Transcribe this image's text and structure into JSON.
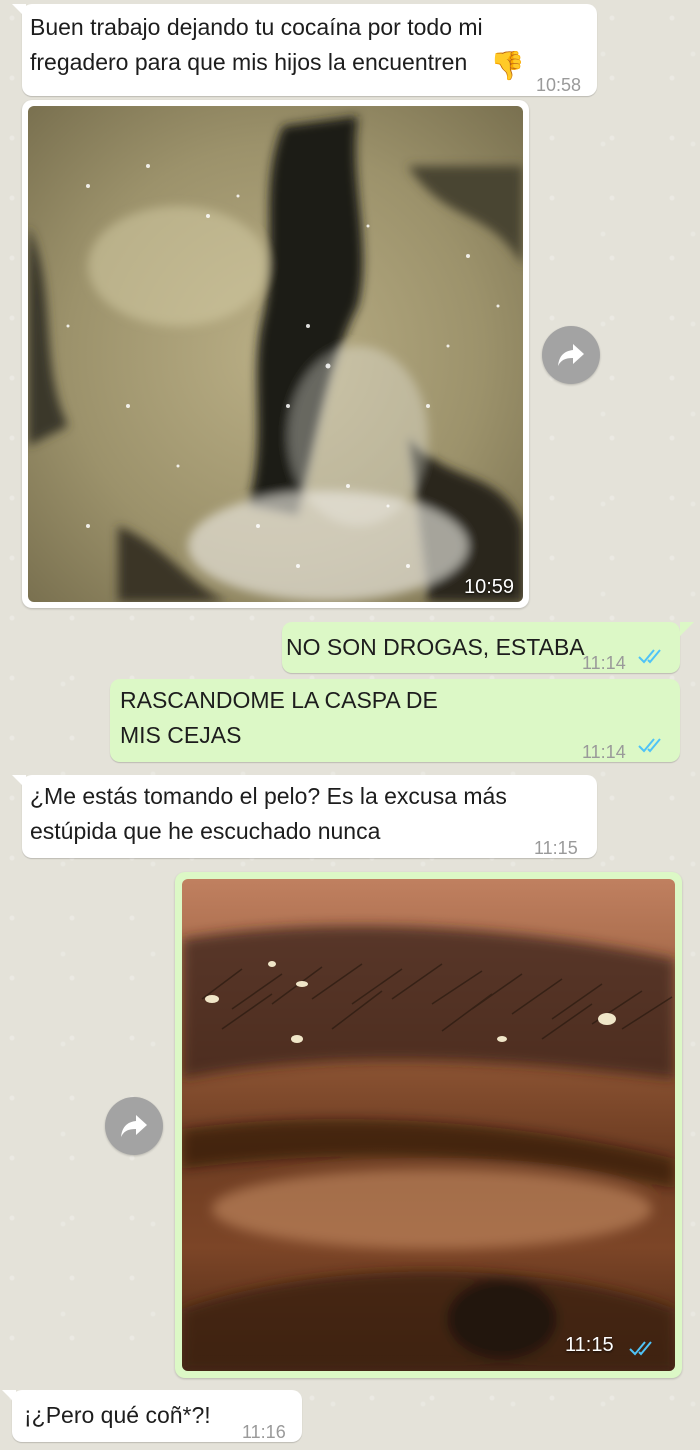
{
  "messages": [
    {
      "text": "Buen trabajo dejando tu cocaína por todo mi fregadero para que mis hijos la encuentren",
      "time": "10:58"
    },
    {
      "image": "marble-countertop-photo",
      "time": "10:59"
    },
    {
      "text": "NO SON DROGAS, ESTABA",
      "time": "11:14"
    },
    {
      "text": "RASCANDOME LA CASPA DE\nMIS CEJAS",
      "time": "11:14"
    },
    {
      "text": "¿Me estás tomando el pelo? Es la excusa más estúpida que he escuchado nunca",
      "time": "11:15"
    },
    {
      "image": "eyebrow-closeup-photo",
      "time": "11:15"
    },
    {
      "text": "¡¿Pero qué coñ*?!",
      "time": "11:16"
    }
  ],
  "icons": {
    "thumbs_down": "thumbs-down-emoji",
    "forward": "forward-arrow-icon",
    "read": "double-check-icon"
  },
  "colors": {
    "incoming_bubble": "#ffffff",
    "outgoing_bubble": "#dcf8c6",
    "read_ticks": "#4fc3f7",
    "chat_background": "#e4e2d9"
  }
}
